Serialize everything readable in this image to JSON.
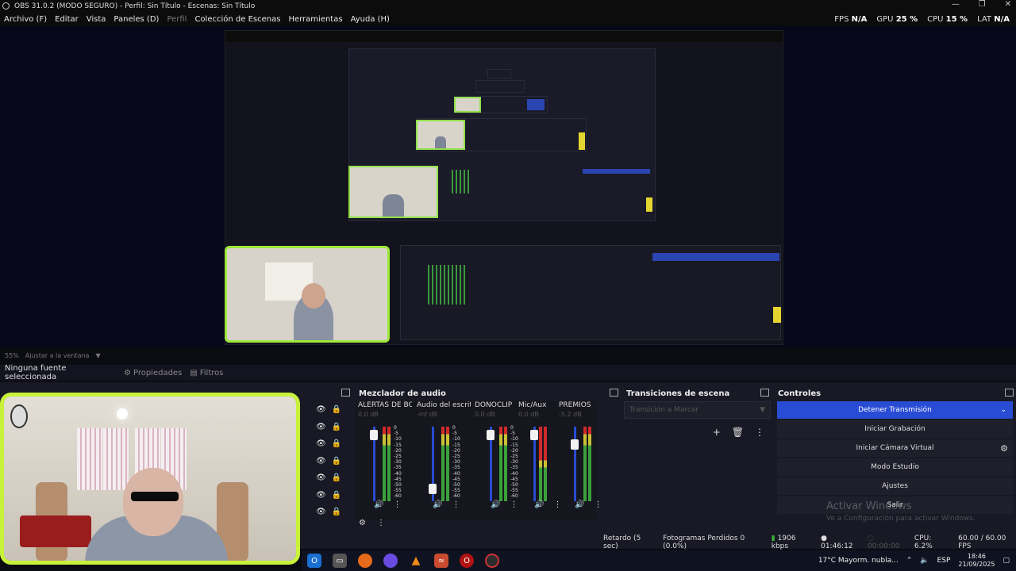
{
  "titlebar": {
    "title": "OBS 31.0.2 (MODO SEGURO) - Perfil: Sin Título - Escenas: Sin Título",
    "minimize": "—",
    "restore": "❐",
    "close": "✕"
  },
  "menu": {
    "items": [
      {
        "label": "Archivo (F)",
        "disabled": false
      },
      {
        "label": "Editar",
        "disabled": false
      },
      {
        "label": "Vista",
        "disabled": false
      },
      {
        "label": "Paneles (D)",
        "disabled": false
      },
      {
        "label": "Perfil",
        "disabled": true
      },
      {
        "label": "Colección de Escenas",
        "disabled": false
      },
      {
        "label": "Herramientas",
        "disabled": false
      },
      {
        "label": "Ayuda (H)",
        "disabled": false
      }
    ]
  },
  "stats": {
    "fps_label": "FPS",
    "fps_value": "N/A",
    "gpu_label": "GPU",
    "gpu_value": "25 %",
    "cpu_label": "CPU",
    "cpu_value": "15 %",
    "lat_label": "LAT",
    "lat_value": "N/A"
  },
  "preview": {
    "zoom": "55%",
    "fit_label": "Ajustar a la ventana",
    "chevron": "▼"
  },
  "sourcebar": {
    "no_source": "Ninguna fuente seleccionada",
    "properties": "Propiedades",
    "filters": "Filtros",
    "gear": "⚙",
    "filter_icon": "▤"
  },
  "docks": {
    "mixer_title": "Mezclador de audio",
    "transitions_title": "Transiciones de escena",
    "controls_title": "Controles"
  },
  "mixer": {
    "channels": [
      {
        "name": "ALERTAS DE BOT",
        "db": "0.0 dB",
        "fader": 0.05,
        "meter_color": "#2a4bd0"
      },
      {
        "name": "Audio del escrito",
        "db": "-inf dB",
        "fader": 0.88,
        "meter_color": "#2a4bd0"
      },
      {
        "name": "DONOCLIP",
        "db": "0.0 dB",
        "fader": 0.05,
        "meter_color": "#2a4bd0"
      },
      {
        "name": "Mic/Aux",
        "db": "0.0 dB",
        "fader": 0.05,
        "meter_color": "#2a4bd0"
      },
      {
        "name": "PREMIOS",
        "db": "-5.2 dB",
        "fader": 0.2,
        "meter_color": "#2a4bd0"
      }
    ],
    "scale": [
      "0",
      "-5",
      "-10",
      "-15",
      "-20",
      "-25",
      "-30",
      "-35",
      "-40",
      "-45",
      "-50",
      "-55",
      "-60"
    ],
    "speaker": "🔊",
    "menu_dots": "⋮",
    "eye": "👁",
    "lock": "🔒"
  },
  "transitions": {
    "selected": "Transición a Marcar",
    "add": "+",
    "delete": "🗑",
    "more": "⋮"
  },
  "controls": {
    "buttons": [
      {
        "label": "Detener Transmisión",
        "active": true
      },
      {
        "label": "Iniciar Grabación",
        "active": false
      },
      {
        "label": "Iniciar Cámara Virtual",
        "active": false
      },
      {
        "label": "Modo Estudio",
        "active": false
      },
      {
        "label": "Ajustes",
        "active": false
      },
      {
        "label": "Salir",
        "active": false
      }
    ],
    "chevron": "⌄",
    "gear": "⚙"
  },
  "watermark": {
    "title": "Activar Windows",
    "subtitle": "Ve a Configuración para activar Windows."
  },
  "status": {
    "delay": "Retardo (5 sec)",
    "dropped": "Fotogramas Perdidos 0 (0.0%)",
    "bitrate": "1906 kbps",
    "stream_time": "01:46:12",
    "rec_time": "00:00:00",
    "cpu": "CPU: 6.2%",
    "fps": "60.00 / 60.00 FPS"
  },
  "taskbar": {
    "weather": "17°C  Mayorm. nubla...",
    "lang": "ESP",
    "time": "18:46",
    "date": "21/09/2025"
  },
  "colors": {
    "accent": "#284cd4",
    "frame_green": "#c8f23a",
    "panel": "#191925"
  }
}
